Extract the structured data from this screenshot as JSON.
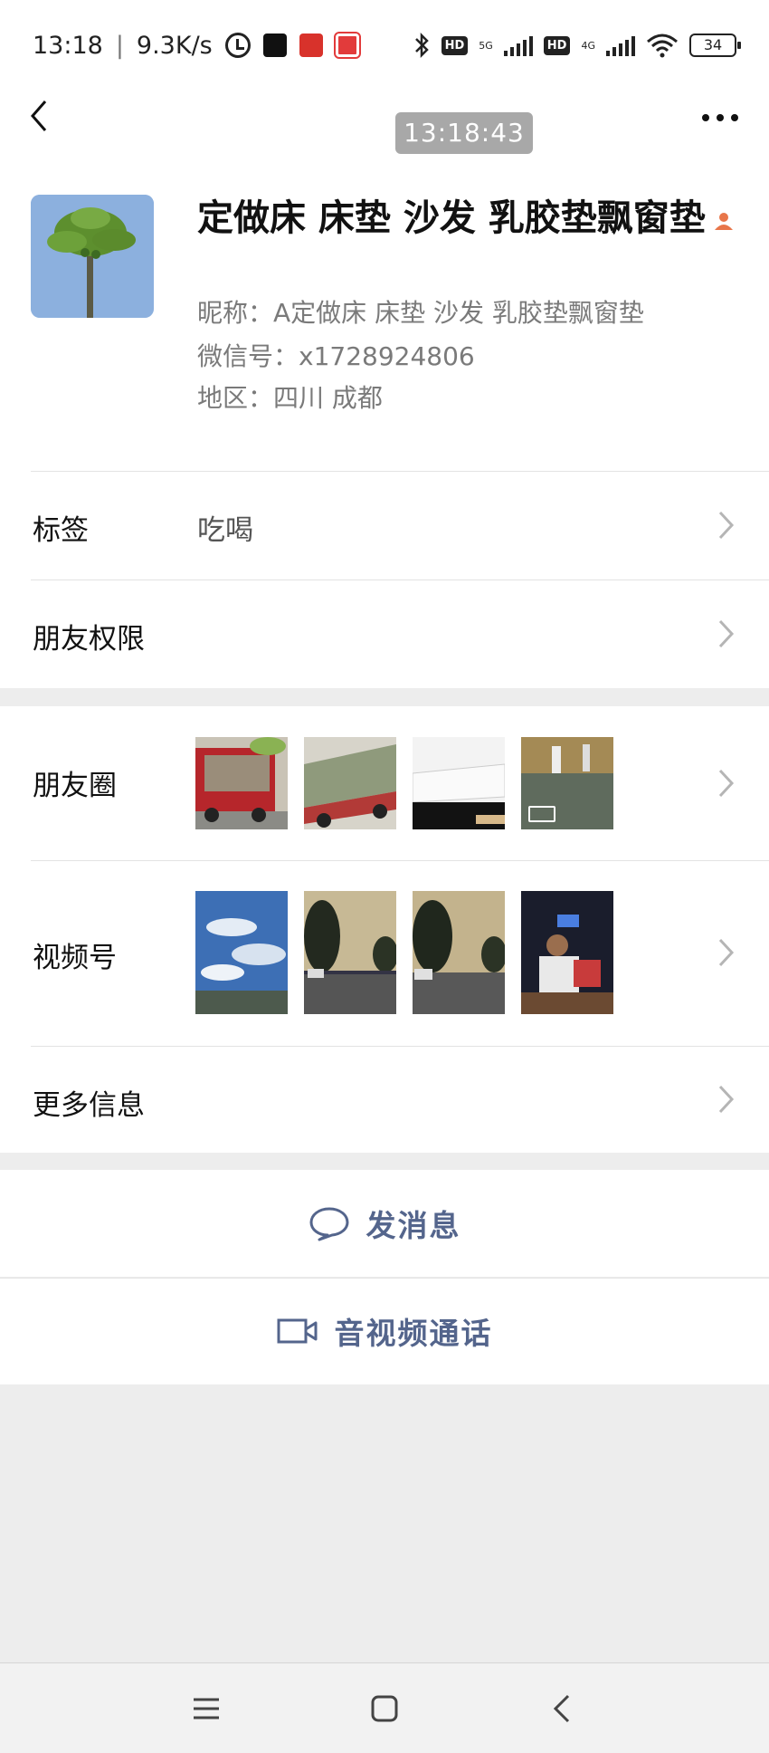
{
  "status_bar": {
    "time": "13:18",
    "separator": "|",
    "network_speed": "9.3K/s",
    "signal1_label": "5G",
    "signal2_label": "4G",
    "hd_label": "HD",
    "battery": "34"
  },
  "nav": {
    "timestamp_badge": "13:18:43"
  },
  "profile": {
    "display_name": "定做床 床垫 沙发 乳胶垫飘窗垫",
    "nickname_label": "昵称：",
    "nickname": "A定做床 床垫 沙发 乳胶垫飘窗垫",
    "wechat_id_label": "微信号：",
    "wechat_id": "x1728924806",
    "region_label": "地区：",
    "region": "四川  成都"
  },
  "rows": {
    "tags_label": "标签",
    "tags_value": "吃喝",
    "friend_permissions_label": "朋友权限",
    "moments_label": "朋友圈",
    "channels_label": "视频号",
    "more_info_label": "更多信息"
  },
  "actions": {
    "send_message": "发消息",
    "av_call": "音视频通话"
  },
  "colors": {
    "accent_text": "#54658c",
    "page_background": "#ededed",
    "person_icon": "#e8764a"
  },
  "icons": [
    "back-arrow-icon",
    "more-dots-icon",
    "person-icon",
    "chevron-right-icon",
    "chat-bubble-icon",
    "video-camera-icon",
    "menu-lines-icon",
    "home-square-icon",
    "back-chevron-icon"
  ]
}
